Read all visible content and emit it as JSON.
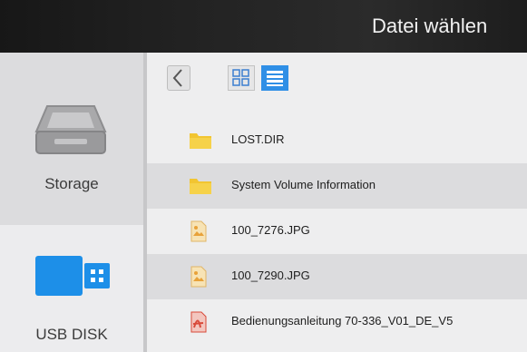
{
  "header": {
    "title": "Datei wählen"
  },
  "sidebar": {
    "items": [
      {
        "label": "Storage",
        "icon": "storage-icon"
      },
      {
        "label": "USB DISK",
        "icon": "usb-disk-icon"
      }
    ]
  },
  "toolbar": {
    "back_icon": "chevron-left-icon",
    "views": [
      "grid-view-icon",
      "list-view-icon"
    ],
    "active_view": "list"
  },
  "files": [
    {
      "name": "LOST.DIR",
      "icon": "folder-icon"
    },
    {
      "name": "System Volume Information",
      "icon": "folder-icon"
    },
    {
      "name": "100_7276.JPG",
      "icon": "image-file-icon"
    },
    {
      "name": "100_7290.JPG",
      "icon": "image-file-icon"
    },
    {
      "name": "Bedienungsanleitung 70-336_V01_DE_V5",
      "icon": "pdf-file-icon"
    }
  ],
  "colors": {
    "accent": "#2f8fe6",
    "folder": "#f2c531",
    "pdf": "#d84a3a",
    "titlebar": "#222222"
  }
}
